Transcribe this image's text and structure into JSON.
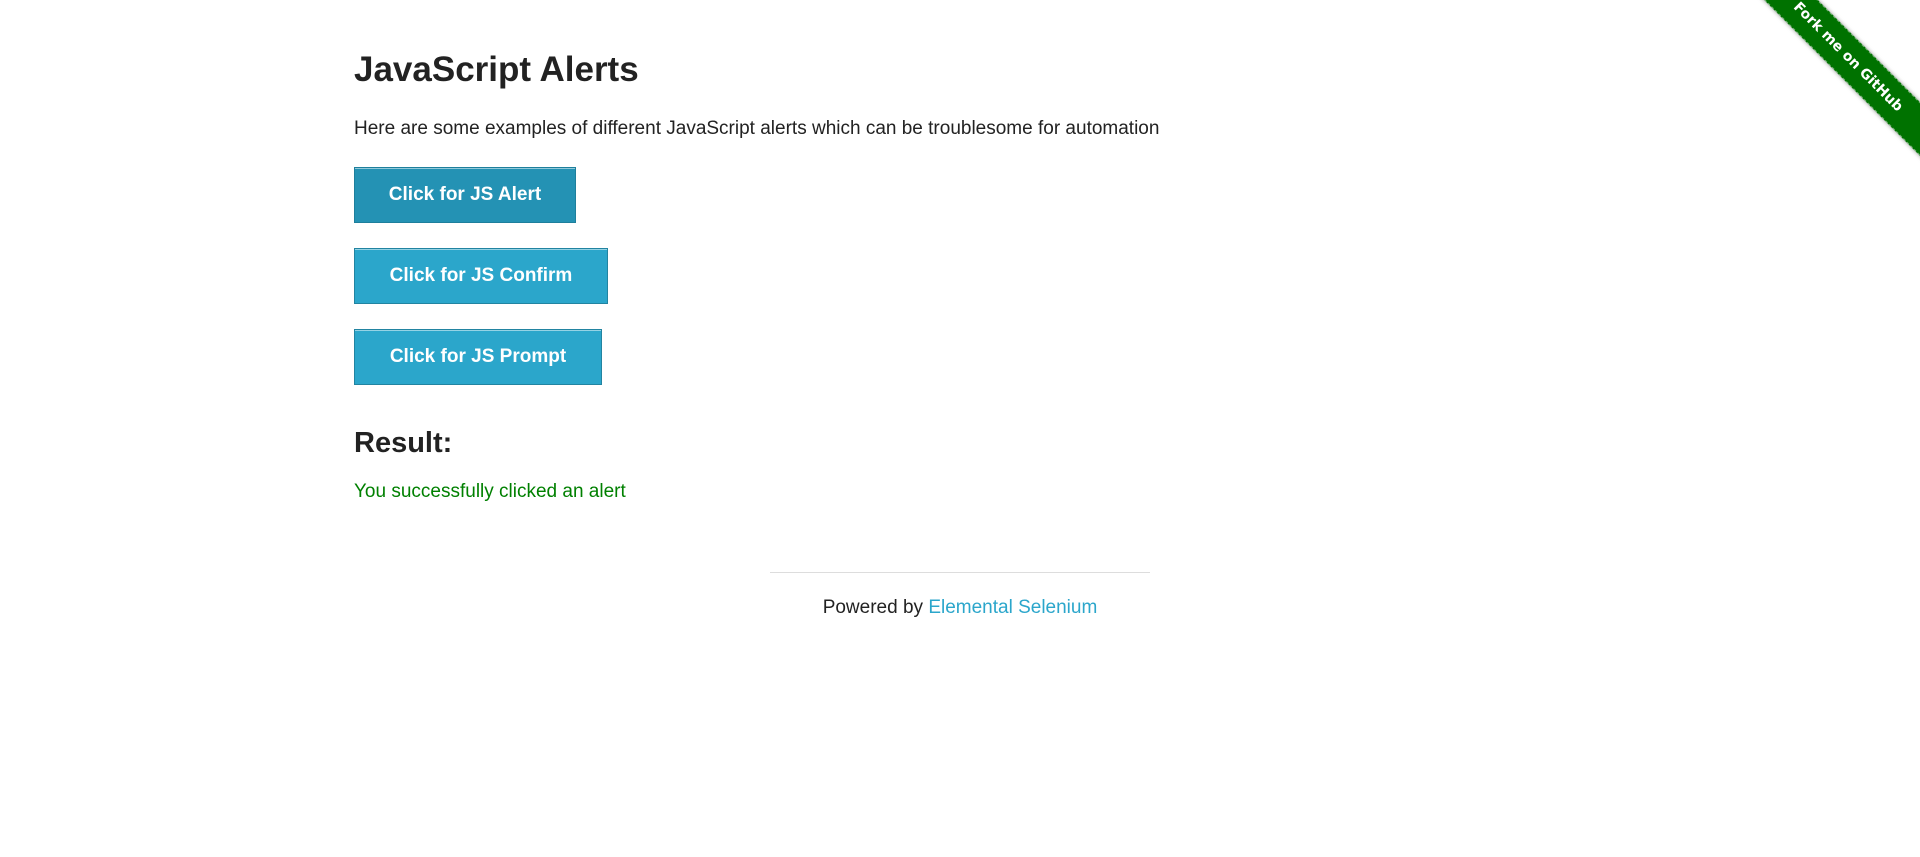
{
  "header": {
    "title": "JavaScript Alerts",
    "intro": "Here are some examples of different JavaScript alerts which can be troublesome for automation"
  },
  "buttons": [
    {
      "label": "Click for JS Alert"
    },
    {
      "label": "Click for JS Confirm"
    },
    {
      "label": "Click for JS Prompt"
    }
  ],
  "result": {
    "heading": "Result:",
    "text": "You successfully clicked an alert",
    "color": "#008000"
  },
  "footer": {
    "prefix": "Powered by ",
    "link_text": "Elemental Selenium"
  },
  "ribbon": {
    "text": "Fork me on GitHub",
    "color": "#007200"
  },
  "colors": {
    "button": "#2ba6cb",
    "link": "#2ba6cb"
  }
}
